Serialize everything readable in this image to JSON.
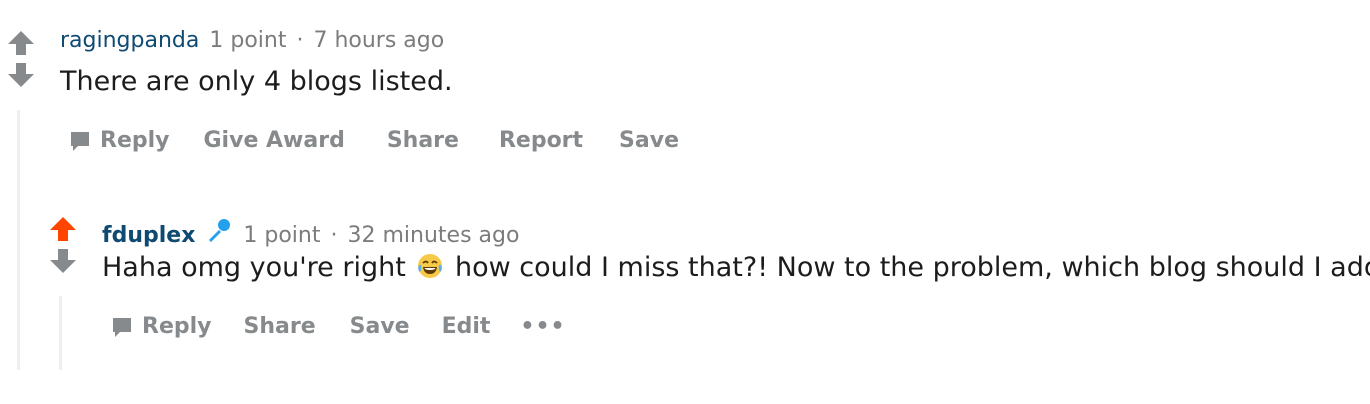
{
  "colors": {
    "upvoted": "#ff4500",
    "vote_neutral": "#878a8c",
    "author": "#0f4a72",
    "meta": "#7c7c7c",
    "action": "#878a8c",
    "thread_line": "#edeff1",
    "flair": "#24a0ed"
  },
  "comment1": {
    "author": "ragingpanda",
    "score": "1 point",
    "separator": "·",
    "time": "7 hours ago",
    "body": "There are only 4 blogs listed.",
    "actions": {
      "reply": "Reply",
      "give_award": "Give Award",
      "share": "Share",
      "report": "Report",
      "save": "Save"
    }
  },
  "comment2": {
    "author": "fduplex",
    "flair_icon": "microphone-icon",
    "score": "1 point",
    "separator": "·",
    "time": "32 minutes ago",
    "body_before": "Haha omg you're right",
    "emoji": "laughing-tears-emoji",
    "body_after": "how could I miss that?! Now to the problem, which blog should I add?",
    "upvoted": true,
    "actions": {
      "reply": "Reply",
      "share": "Share",
      "save": "Save",
      "edit": "Edit",
      "more": "•••"
    }
  }
}
